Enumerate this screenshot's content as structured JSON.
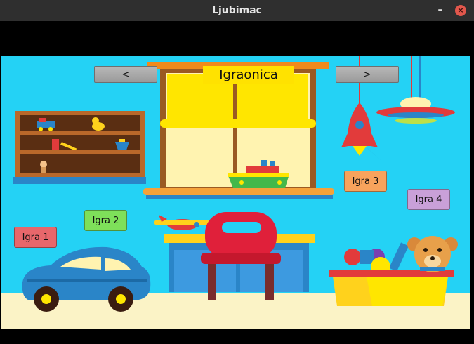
{
  "window": {
    "title": "Ljubimac",
    "minimize_glyph": "–",
    "close_glyph": "×"
  },
  "header": {
    "title": "Igraonica",
    "prev_label": "<",
    "next_label": ">"
  },
  "games": [
    {
      "label": "Igra 1",
      "color": "#e8676b"
    },
    {
      "label": "Igra 2",
      "color": "#7ee05a"
    },
    {
      "label": "Igra 3",
      "color": "#f7a35c"
    },
    {
      "label": "Igra 4",
      "color": "#c9a0d8"
    }
  ],
  "icons": {
    "shelf": "toy-shelf-icon",
    "window": "window-icon",
    "ship": "toy-ship-icon",
    "rocket": "rocket-icon",
    "ufo": "ufo-lamp-icon",
    "plane": "toy-plane-icon",
    "desk": "desk-icon",
    "chair": "chair-icon",
    "car": "toy-car-icon",
    "toybox": "toy-box-icon",
    "bear": "teddy-bear-icon"
  },
  "colors": {
    "background": "#24d2f5",
    "floor": "#fbf3c6",
    "accent": "#ffe200"
  }
}
